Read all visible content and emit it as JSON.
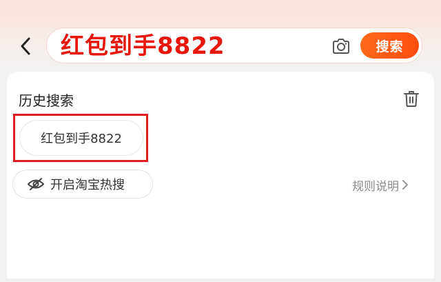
{
  "header": {
    "back_icon": "chevron-left-icon",
    "search": {
      "query": "红包到手8822",
      "camera_icon": "camera-icon",
      "button_label": "搜索"
    }
  },
  "history": {
    "title": "历史搜索",
    "delete_icon": "trash-icon",
    "items": [
      {
        "label": "红包到手8822"
      }
    ],
    "highlight_color": "#e11b1b"
  },
  "hot_search": {
    "icon": "eye-off-icon",
    "label": "开启淘宝热搜"
  },
  "rules": {
    "label": "规则说明",
    "icon": "chevron-right-icon"
  },
  "colors": {
    "accent": "#ff5a14",
    "query_text": "#e8170c"
  }
}
